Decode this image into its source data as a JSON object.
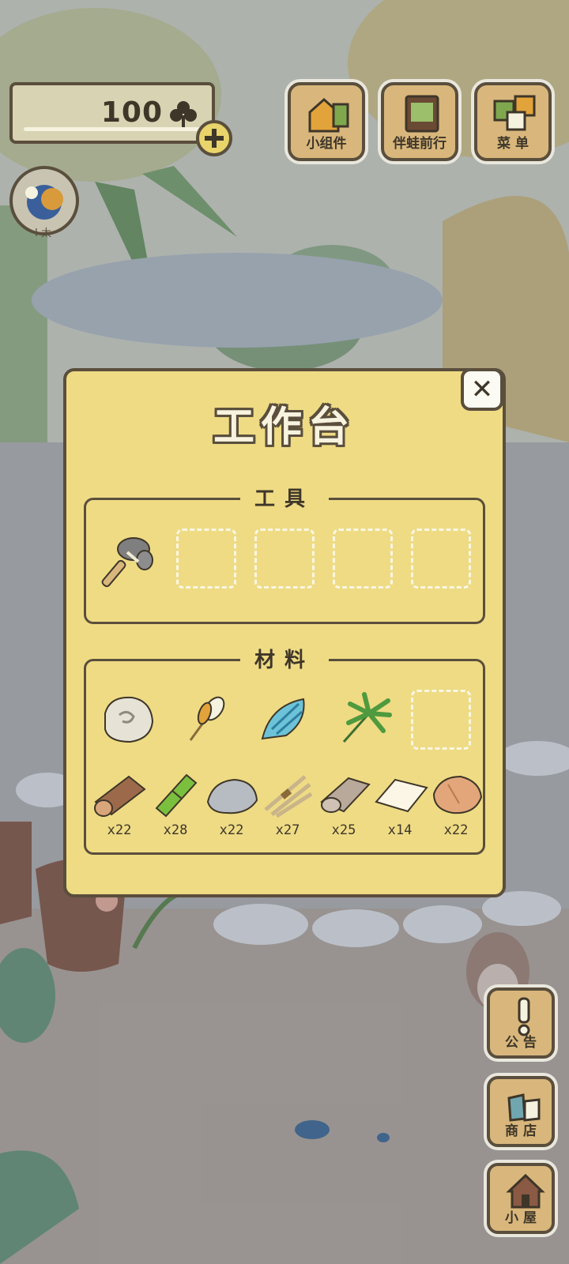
{
  "currency": {
    "amount": "100",
    "icon": "clover-icon"
  },
  "avatar": {
    "tag": "I 太"
  },
  "top_buttons": [
    {
      "label": "小组件",
      "icon": "widget-icon"
    },
    {
      "label": "伴蛙前行",
      "icon": "book-icon"
    },
    {
      "label": "菜 单",
      "icon": "menu-cards-icon"
    }
  ],
  "side_buttons": [
    {
      "label": "公 告",
      "icon": "exclamation-icon"
    },
    {
      "label": "商 店",
      "icon": "shop-bags-icon"
    },
    {
      "label": "小 屋",
      "icon": "house-icon"
    }
  ],
  "workbench": {
    "title": "工作台",
    "close": "✕",
    "tools": {
      "title": "工具",
      "items": [
        {
          "name": "stone-axe"
        },
        null,
        null,
        null,
        null
      ]
    },
    "materials": {
      "title": "材料",
      "special": [
        "stone-tablet",
        "feather-bundle",
        "blue-shell",
        "palm-leaf",
        null
      ],
      "stock": [
        {
          "name": "log",
          "qty": "x22"
        },
        {
          "name": "bamboo",
          "qty": "x28"
        },
        {
          "name": "stone",
          "qty": "x22"
        },
        {
          "name": "fiber-bundle",
          "qty": "x27"
        },
        {
          "name": "cloth-roll",
          "qty": "x25"
        },
        {
          "name": "paper",
          "qty": "x14"
        },
        {
          "name": "leather",
          "qty": "x22"
        }
      ]
    }
  },
  "colors": {
    "panel": "#eedb84",
    "outline": "#5a4e3c",
    "button": "#d9b77c"
  }
}
